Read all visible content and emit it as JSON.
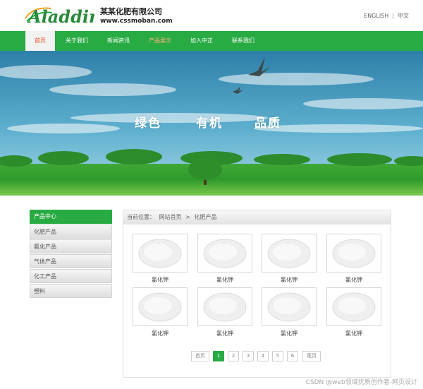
{
  "colors": {
    "brand_green": "#28ab43",
    "active_nav_text": "#e8592a",
    "highlight_nav_text": "#ffb27a"
  },
  "header": {
    "logo_text": "Aladdin",
    "company_name": "某某化肥有限公司",
    "website": "www.cssmoban.com",
    "lang_en": "ENGLISH",
    "lang_cn": "中文"
  },
  "nav": {
    "items": [
      {
        "label": "首页"
      },
      {
        "label": "关于我们"
      },
      {
        "label": "新闻资讯"
      },
      {
        "label": "产品展示"
      },
      {
        "label": "加入中正"
      },
      {
        "label": "联系我们"
      }
    ]
  },
  "banner": {
    "slogans": [
      "绿色",
      "有机",
      "品质"
    ]
  },
  "sidebar": {
    "title": "产品中心",
    "items": [
      {
        "label": "化肥产品"
      },
      {
        "label": "氨化产品"
      },
      {
        "label": "气体产品"
      },
      {
        "label": "化工产品"
      },
      {
        "label": "塑料"
      }
    ]
  },
  "breadcrumb": {
    "prefix": "当前位置：",
    "home": "网站首页",
    "separator": ">",
    "current": "化肥产品"
  },
  "products": [
    {
      "name": "氯化钾"
    },
    {
      "name": "氯化钾"
    },
    {
      "name": "氯化钾"
    },
    {
      "name": "氯化钾"
    },
    {
      "name": "氯化钾"
    },
    {
      "name": "氯化钾"
    },
    {
      "name": "氯化钾"
    },
    {
      "name": "氯化钾"
    }
  ],
  "pagination": {
    "first": "首页",
    "pages": [
      "1",
      "2",
      "3",
      "4",
      "5",
      "6"
    ],
    "current": "1",
    "last": "尾页"
  },
  "watermark": "CSDN @web领域优质创作者-网页设计"
}
